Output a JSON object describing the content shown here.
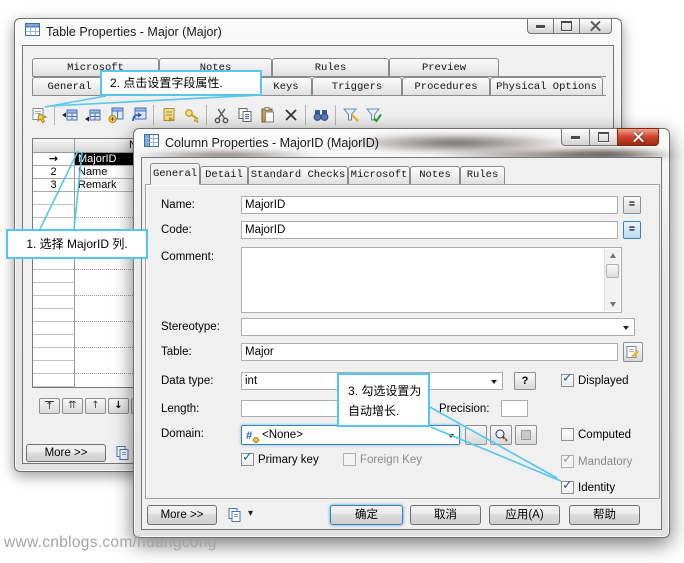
{
  "colors": {
    "callout": "#55c6ee",
    "selection_bg": "#000000",
    "close_red": "#cf4432"
  },
  "icons": {
    "check": "✓",
    "row_selector_arrow": "→",
    "move_first": "↑",
    "move_up_double": "⇈",
    "move_up": "↑",
    "move_down": "↓",
    "move_last": "⇊",
    "menu_caret": "▾"
  },
  "watermark": "www.cnblogs.com/huangcong",
  "back_window": {
    "title": "Table Properties - Major (Major)",
    "tabs_row1": [
      "Microsoft",
      "Notes",
      "Rules",
      "Preview"
    ],
    "tabs_row2": [
      "General",
      "",
      "",
      "Keys",
      "Triggers",
      "Procedures",
      "Physical Options"
    ],
    "grid": {
      "header_col2": "N",
      "rows": [
        {
          "num": "",
          "name": "MajorID"
        },
        {
          "num": "2",
          "name": "Name"
        },
        {
          "num": "3",
          "name": "Remark"
        }
      ],
      "empty_rows": 15
    },
    "more_button": "More >>"
  },
  "dialog": {
    "title": "Column Properties - MajorID (MajorID)",
    "tabs": [
      "General",
      "Detail",
      "Standard Checks",
      "Microsoft",
      "Notes",
      "Rules"
    ],
    "fields": {
      "name_label": "Name:",
      "name_value": "MajorID",
      "code_label": "Code:",
      "code_value": "MajorID",
      "comment_label": "Comment:",
      "comment_value": "",
      "stereotype_label": "Stereotype:",
      "stereotype_value": "",
      "table_label": "Table:",
      "table_value": "Major",
      "datatype_label": "Data type:",
      "datatype_value": "int",
      "length_label": "Length:",
      "length_value": "",
      "precision_label": "Precision:",
      "precision_value": "",
      "domain_label": "Domain:",
      "domain_value": "<None>",
      "equals": "=",
      "help": "?"
    },
    "checkboxes": {
      "displayed": {
        "label": "Displayed",
        "checked": true
      },
      "computed": {
        "label": "Computed",
        "checked": false
      },
      "mandatory": {
        "label": "Mandatory",
        "checked": true,
        "disabled": true
      },
      "identity": {
        "label": "Identity",
        "checked": true
      },
      "primary_key": {
        "label": "Primary key",
        "checked": true
      },
      "foreign_key": {
        "label": "Foreign Key",
        "checked": false,
        "disabled": true
      }
    },
    "buttons": {
      "more": "More >>",
      "ok": "确定",
      "cancel": "取消",
      "apply": "应用(A)",
      "help": "帮助"
    }
  },
  "callouts": {
    "c1": "1. 选择 MajorID 列.",
    "c2": "2. 点击设置字段属性.",
    "c3_line1": "3. 勾选设置为",
    "c3_line2": "自动增长."
  }
}
